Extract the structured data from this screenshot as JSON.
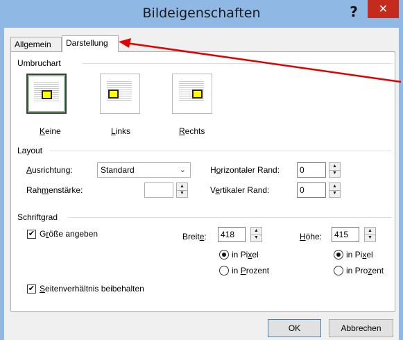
{
  "window": {
    "title": "Bildeigenschaften",
    "help_symbol": "?",
    "close_symbol": "✕"
  },
  "tabs": [
    {
      "label": "Allgemein",
      "active": false
    },
    {
      "label": "Darstellung",
      "active": true
    }
  ],
  "wrap_group": {
    "title": "Umbruchart",
    "options": [
      {
        "label_u": "K",
        "label_rest": "eine",
        "selected": true
      },
      {
        "label_u": "L",
        "label_rest": "inks",
        "selected": false
      },
      {
        "label_u": "R",
        "label_rest": "echts",
        "selected": false
      }
    ]
  },
  "layout_group": {
    "title": "Layout",
    "alignment_label_u": "A",
    "alignment_label_rest": "usrichtung:",
    "alignment_value": "Standard",
    "border_label_pre": "Rah",
    "border_label_u": "m",
    "border_label_post": "enstärke:",
    "border_value": "",
    "hspace_label_pre": "H",
    "hspace_label_u": "o",
    "hspace_label_post": "rizontaler Rand:",
    "hspace_value": "0",
    "vspace_label_pre": "V",
    "vspace_label_u": "e",
    "vspace_label_post": "rtikaler Rand:",
    "vspace_value": "0"
  },
  "size_group": {
    "title": "Schriftgrad",
    "specify_size_pre": "G",
    "specify_size_u": "r",
    "specify_size_post": "öße angeben",
    "specify_size_checked": true,
    "width_label_pre": "Breit",
    "width_label_u": "e",
    "width_label_post": ":",
    "width_value": "418",
    "height_label_u": "H",
    "height_label_rest": "öhe:",
    "height_value": "415",
    "width_pixel_pre": "in Pi",
    "width_pixel_u": "x",
    "width_pixel_post": "el",
    "width_percent_pre": "in ",
    "width_percent_u": "P",
    "width_percent_post": "rozent",
    "height_pixel_pre": "in Pi",
    "height_pixel_u": "x",
    "height_pixel_post": "el",
    "height_percent_pre": "in Pro",
    "height_percent_u": "z",
    "height_percent_post": "ent",
    "width_unit": "pixel",
    "height_unit": "pixel",
    "keep_ratio_u": "S",
    "keep_ratio_rest": "eitenverhältnis beibehalten",
    "keep_ratio_checked": true
  },
  "buttons": {
    "ok": "OK",
    "cancel": "Abbrechen"
  },
  "colors": {
    "titlebar": "#8fb9e4",
    "close_button": "#c42b1c",
    "annotation_arrow": "#e00000",
    "wrap_box_fill": "#ffff00"
  },
  "icons": {
    "spinner_up": "▲",
    "spinner_down": "▼",
    "dropdown": "⌄",
    "checkmark": "✔"
  }
}
